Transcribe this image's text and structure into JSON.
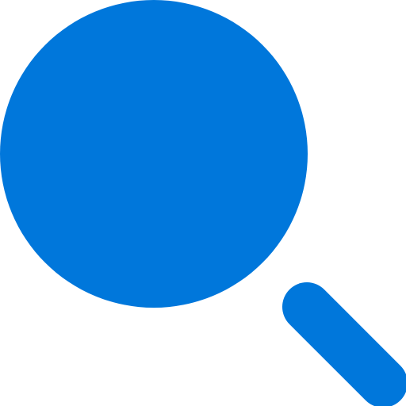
{
  "icon": {
    "name": "search-icon",
    "color": "#0077DB",
    "background": "#FFFFFF"
  }
}
